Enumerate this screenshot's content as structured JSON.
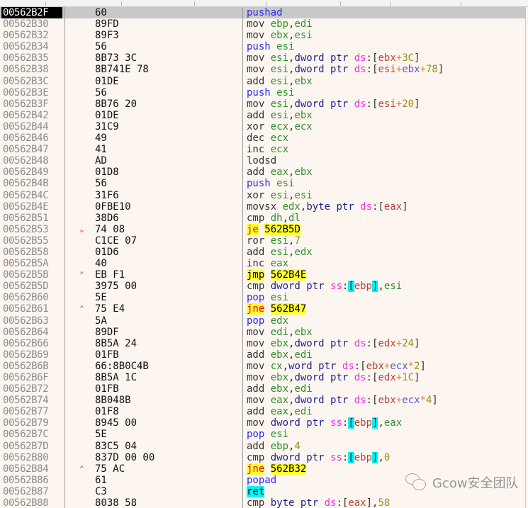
{
  "watermark": {
    "text": "Gcow安全团队",
    "icon": "wechat-icon"
  },
  "rows": [
    {
      "addr": "00562B2F",
      "arrow": "",
      "bytes": "60",
      "selected": true,
      "instr": [
        [
          "stack",
          "pushad"
        ]
      ]
    },
    {
      "addr": "00562B30",
      "arrow": "",
      "bytes": "89FD",
      "instr": [
        [
          "mn",
          "mov "
        ],
        [
          "reg",
          "ebp"
        ],
        [
          "plain",
          ","
        ],
        [
          "reg",
          "edi"
        ]
      ]
    },
    {
      "addr": "00562B32",
      "arrow": "",
      "bytes": "89F3",
      "instr": [
        [
          "mn",
          "mov "
        ],
        [
          "reg",
          "ebx"
        ],
        [
          "plain",
          ","
        ],
        [
          "reg",
          "esi"
        ]
      ]
    },
    {
      "addr": "00562B34",
      "arrow": "",
      "bytes": "56",
      "instr": [
        [
          "stack",
          "push "
        ],
        [
          "reg",
          "esi"
        ]
      ]
    },
    {
      "addr": "00562B35",
      "arrow": "",
      "bytes": "8B73 3C",
      "instr": [
        [
          "mn",
          "mov "
        ],
        [
          "reg",
          "esi"
        ],
        [
          "plain",
          ","
        ],
        [
          "size",
          "dword ptr "
        ],
        [
          "seg",
          "ds"
        ],
        [
          "colon",
          ":"
        ],
        [
          "br",
          "["
        ],
        [
          "mreg",
          "ebx"
        ],
        [
          "op",
          "+"
        ],
        [
          "num",
          "3C"
        ],
        [
          "br",
          "]"
        ]
      ]
    },
    {
      "addr": "00562B38",
      "arrow": "",
      "bytes": "8B741E 78",
      "instr": [
        [
          "mn",
          "mov "
        ],
        [
          "reg",
          "esi"
        ],
        [
          "plain",
          ","
        ],
        [
          "size",
          "dword ptr "
        ],
        [
          "seg",
          "ds"
        ],
        [
          "colon",
          ":"
        ],
        [
          "br",
          "["
        ],
        [
          "mreg",
          "esi"
        ],
        [
          "op",
          "+"
        ],
        [
          "ireg",
          "ebx"
        ],
        [
          "op",
          "+"
        ],
        [
          "num",
          "78"
        ],
        [
          "br",
          "]"
        ]
      ]
    },
    {
      "addr": "00562B3C",
      "arrow": "",
      "bytes": "01DE",
      "instr": [
        [
          "mn",
          "add "
        ],
        [
          "reg",
          "esi"
        ],
        [
          "plain",
          ","
        ],
        [
          "reg",
          "ebx"
        ]
      ]
    },
    {
      "addr": "00562B3E",
      "arrow": "",
      "bytes": "56",
      "instr": [
        [
          "stack",
          "push "
        ],
        [
          "reg",
          "esi"
        ]
      ]
    },
    {
      "addr": "00562B3F",
      "arrow": "",
      "bytes": "8B76 20",
      "instr": [
        [
          "mn",
          "mov "
        ],
        [
          "reg",
          "esi"
        ],
        [
          "plain",
          ","
        ],
        [
          "size",
          "dword ptr "
        ],
        [
          "seg",
          "ds"
        ],
        [
          "colon",
          ":"
        ],
        [
          "br",
          "["
        ],
        [
          "mreg",
          "esi"
        ],
        [
          "op",
          "+"
        ],
        [
          "num",
          "20"
        ],
        [
          "br",
          "]"
        ]
      ]
    },
    {
      "addr": "00562B42",
      "arrow": "",
      "bytes": "01DE",
      "instr": [
        [
          "mn",
          "add "
        ],
        [
          "reg",
          "esi"
        ],
        [
          "plain",
          ","
        ],
        [
          "reg",
          "ebx"
        ]
      ]
    },
    {
      "addr": "00562B44",
      "arrow": "",
      "bytes": "31C9",
      "instr": [
        [
          "mn",
          "xor "
        ],
        [
          "reg",
          "ecx"
        ],
        [
          "plain",
          ","
        ],
        [
          "reg",
          "ecx"
        ]
      ]
    },
    {
      "addr": "00562B46",
      "arrow": "",
      "bytes": "49",
      "instr": [
        [
          "mn",
          "dec "
        ],
        [
          "reg",
          "ecx"
        ]
      ]
    },
    {
      "addr": "00562B47",
      "arrow": "",
      "bytes": "41",
      "instr": [
        [
          "mn",
          "inc "
        ],
        [
          "reg",
          "ecx"
        ]
      ]
    },
    {
      "addr": "00562B48",
      "arrow": "",
      "bytes": "AD",
      "instr": [
        [
          "mn",
          "lodsd"
        ]
      ]
    },
    {
      "addr": "00562B49",
      "arrow": "",
      "bytes": "01D8",
      "instr": [
        [
          "mn",
          "add "
        ],
        [
          "reg",
          "eax"
        ],
        [
          "plain",
          ","
        ],
        [
          "reg",
          "ebx"
        ]
      ]
    },
    {
      "addr": "00562B4B",
      "arrow": "",
      "bytes": "56",
      "instr": [
        [
          "stack",
          "push "
        ],
        [
          "reg",
          "esi"
        ]
      ]
    },
    {
      "addr": "00562B4C",
      "arrow": "",
      "bytes": "31F6",
      "instr": [
        [
          "mn",
          "xor "
        ],
        [
          "reg",
          "esi"
        ],
        [
          "plain",
          ","
        ],
        [
          "reg",
          "esi"
        ]
      ]
    },
    {
      "addr": "00562B4E",
      "arrow": "",
      "bytes": "0FBE10",
      "instr": [
        [
          "mn",
          "movsx "
        ],
        [
          "reg",
          "edx"
        ],
        [
          "plain",
          ","
        ],
        [
          "size",
          "byte ptr "
        ],
        [
          "seg",
          "ds"
        ],
        [
          "colon",
          ":"
        ],
        [
          "br",
          "["
        ],
        [
          "mreg",
          "eax"
        ],
        [
          "br",
          "]"
        ]
      ]
    },
    {
      "addr": "00562B51",
      "arrow": "",
      "bytes": "38D6",
      "instr": [
        [
          "mn",
          "cmp "
        ],
        [
          "reg",
          "dh"
        ],
        [
          "plain",
          ","
        ],
        [
          "reg",
          "dl"
        ]
      ]
    },
    {
      "addr": "00562B53",
      "arrow": "down",
      "bytes": "74 08",
      "instr": [
        [
          "jmp",
          "je"
        ],
        [
          "plain",
          " "
        ],
        [
          "tgt",
          "562B5D"
        ]
      ]
    },
    {
      "addr": "00562B55",
      "arrow": "",
      "bytes": "C1CE 07",
      "instr": [
        [
          "mn",
          "ror "
        ],
        [
          "reg",
          "esi"
        ],
        [
          "plain",
          ","
        ],
        [
          "num",
          "7"
        ]
      ]
    },
    {
      "addr": "00562B58",
      "arrow": "",
      "bytes": "01D6",
      "instr": [
        [
          "mn",
          "add "
        ],
        [
          "reg",
          "esi"
        ],
        [
          "plain",
          ","
        ],
        [
          "reg",
          "edx"
        ]
      ]
    },
    {
      "addr": "00562B5A",
      "arrow": "",
      "bytes": "40",
      "instr": [
        [
          "mn",
          "inc "
        ],
        [
          "reg",
          "eax"
        ]
      ]
    },
    {
      "addr": "00562B5B",
      "arrow": "up",
      "bytes": "EB F1",
      "instr": [
        [
          "jmpk",
          "jmp"
        ],
        [
          "plain",
          " "
        ],
        [
          "tgt",
          "562B4E"
        ]
      ]
    },
    {
      "addr": "00562B5D",
      "arrow": "",
      "bytes": "3975 00",
      "instr": [
        [
          "mn",
          "cmp "
        ],
        [
          "size",
          "dword ptr "
        ],
        [
          "seg",
          "ss"
        ],
        [
          "colon",
          ":"
        ],
        [
          "brhl",
          "["
        ],
        [
          "mreg",
          "ebp"
        ],
        [
          "brhl",
          "]"
        ],
        [
          "plain",
          ","
        ],
        [
          "reg",
          "esi"
        ]
      ]
    },
    {
      "addr": "00562B60",
      "arrow": "",
      "bytes": "5E",
      "instr": [
        [
          "stack",
          "pop "
        ],
        [
          "reg",
          "esi"
        ]
      ]
    },
    {
      "addr": "00562B61",
      "arrow": "up",
      "bytes": "75 E4",
      "instr": [
        [
          "jmp",
          "jne"
        ],
        [
          "plain",
          " "
        ],
        [
          "tgt",
          "562B47"
        ]
      ]
    },
    {
      "addr": "00562B63",
      "arrow": "",
      "bytes": "5A",
      "instr": [
        [
          "stack",
          "pop "
        ],
        [
          "reg",
          "edx"
        ]
      ]
    },
    {
      "addr": "00562B64",
      "arrow": "",
      "bytes": "89DF",
      "instr": [
        [
          "mn",
          "mov "
        ],
        [
          "reg",
          "edi"
        ],
        [
          "plain",
          ","
        ],
        [
          "reg",
          "ebx"
        ]
      ]
    },
    {
      "addr": "00562B66",
      "arrow": "",
      "bytes": "8B5A 24",
      "instr": [
        [
          "mn",
          "mov "
        ],
        [
          "reg",
          "ebx"
        ],
        [
          "plain",
          ","
        ],
        [
          "size",
          "dword ptr "
        ],
        [
          "seg",
          "ds"
        ],
        [
          "colon",
          ":"
        ],
        [
          "br",
          "["
        ],
        [
          "mreg",
          "edx"
        ],
        [
          "op",
          "+"
        ],
        [
          "num",
          "24"
        ],
        [
          "br",
          "]"
        ]
      ]
    },
    {
      "addr": "00562B69",
      "arrow": "",
      "bytes": "01FB",
      "instr": [
        [
          "mn",
          "add "
        ],
        [
          "reg",
          "ebx"
        ],
        [
          "plain",
          ","
        ],
        [
          "reg",
          "edi"
        ]
      ]
    },
    {
      "addr": "00562B6B",
      "arrow": "",
      "bytes": "66:8B0C4B",
      "instr": [
        [
          "mn",
          "mov "
        ],
        [
          "reg",
          "cx"
        ],
        [
          "plain",
          ","
        ],
        [
          "size",
          "word ptr "
        ],
        [
          "seg",
          "ds"
        ],
        [
          "colon",
          ":"
        ],
        [
          "br",
          "["
        ],
        [
          "mreg",
          "ebx"
        ],
        [
          "op",
          "+"
        ],
        [
          "ireg",
          "ecx"
        ],
        [
          "op",
          "*"
        ],
        [
          "num",
          "2"
        ],
        [
          "br",
          "]"
        ]
      ]
    },
    {
      "addr": "00562B6F",
      "arrow": "",
      "bytes": "8B5A 1C",
      "instr": [
        [
          "mn",
          "mov "
        ],
        [
          "reg",
          "ebx"
        ],
        [
          "plain",
          ","
        ],
        [
          "size",
          "dword ptr "
        ],
        [
          "seg",
          "ds"
        ],
        [
          "colon",
          ":"
        ],
        [
          "br",
          "["
        ],
        [
          "mreg",
          "edx"
        ],
        [
          "op",
          "+"
        ],
        [
          "num",
          "1C"
        ],
        [
          "br",
          "]"
        ]
      ]
    },
    {
      "addr": "00562B72",
      "arrow": "",
      "bytes": "01FB",
      "instr": [
        [
          "mn",
          "add "
        ],
        [
          "reg",
          "ebx"
        ],
        [
          "plain",
          ","
        ],
        [
          "reg",
          "edi"
        ]
      ]
    },
    {
      "addr": "00562B74",
      "arrow": "",
      "bytes": "8B048B",
      "instr": [
        [
          "mn",
          "mov "
        ],
        [
          "reg",
          "eax"
        ],
        [
          "plain",
          ","
        ],
        [
          "size",
          "dword ptr "
        ],
        [
          "seg",
          "ds"
        ],
        [
          "colon",
          ":"
        ],
        [
          "br",
          "["
        ],
        [
          "mreg",
          "ebx"
        ],
        [
          "op",
          "+"
        ],
        [
          "ireg",
          "ecx"
        ],
        [
          "op",
          "*"
        ],
        [
          "num",
          "4"
        ],
        [
          "br",
          "]"
        ]
      ]
    },
    {
      "addr": "00562B77",
      "arrow": "",
      "bytes": "01F8",
      "instr": [
        [
          "mn",
          "add "
        ],
        [
          "reg",
          "eax"
        ],
        [
          "plain",
          ","
        ],
        [
          "reg",
          "edi"
        ]
      ]
    },
    {
      "addr": "00562B79",
      "arrow": "",
      "bytes": "8945 00",
      "instr": [
        [
          "mn",
          "mov "
        ],
        [
          "size",
          "dword ptr "
        ],
        [
          "seg",
          "ss"
        ],
        [
          "colon",
          ":"
        ],
        [
          "brhl",
          "["
        ],
        [
          "mreg",
          "ebp"
        ],
        [
          "brhl",
          "]"
        ],
        [
          "plain",
          ","
        ],
        [
          "reg",
          "eax"
        ]
      ]
    },
    {
      "addr": "00562B7C",
      "arrow": "",
      "bytes": "5E",
      "instr": [
        [
          "stack",
          "pop "
        ],
        [
          "reg",
          "esi"
        ]
      ]
    },
    {
      "addr": "00562B7D",
      "arrow": "",
      "bytes": "83C5 04",
      "instr": [
        [
          "mn",
          "add "
        ],
        [
          "reg",
          "ebp"
        ],
        [
          "plain",
          ","
        ],
        [
          "num",
          "4"
        ]
      ]
    },
    {
      "addr": "00562B80",
      "arrow": "",
      "bytes": "837D 00 00",
      "instr": [
        [
          "mn",
          "cmp "
        ],
        [
          "size",
          "dword ptr "
        ],
        [
          "seg",
          "ss"
        ],
        [
          "colon",
          ":"
        ],
        [
          "brhl",
          "["
        ],
        [
          "mreg",
          "ebp"
        ],
        [
          "brhl",
          "]"
        ],
        [
          "plain",
          ","
        ],
        [
          "num",
          "0"
        ]
      ]
    },
    {
      "addr": "00562B84",
      "arrow": "up",
      "bytes": "75 AC",
      "instr": [
        [
          "jmp",
          "jne"
        ],
        [
          "plain",
          " "
        ],
        [
          "tgt",
          "562B32"
        ]
      ]
    },
    {
      "addr": "00562B86",
      "arrow": "",
      "bytes": "61",
      "instr": [
        [
          "stack",
          "popad"
        ]
      ]
    },
    {
      "addr": "00562B87",
      "arrow": "",
      "bytes": "C3",
      "instr": [
        [
          "ret",
          "ret"
        ]
      ]
    },
    {
      "addr": "00562B88",
      "arrow": "",
      "bytes": "8038 58",
      "instr": [
        [
          "mn",
          "cmp "
        ],
        [
          "size",
          "byte ptr "
        ],
        [
          "seg",
          "ds"
        ],
        [
          "colon",
          ":"
        ],
        [
          "br",
          "["
        ],
        [
          "mreg",
          "eax"
        ],
        [
          "br",
          "]"
        ],
        [
          "plain",
          ","
        ],
        [
          "num",
          "58"
        ]
      ]
    }
  ],
  "arrows": {
    "down": "⌄",
    "up": "⌃"
  }
}
